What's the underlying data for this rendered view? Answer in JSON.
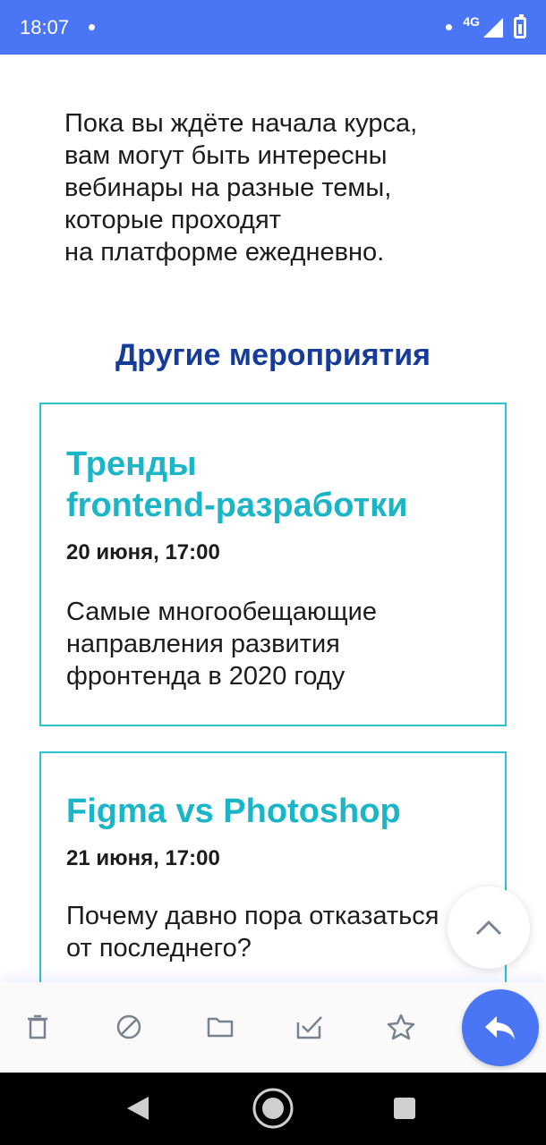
{
  "status_bar": {
    "time": "18:07",
    "network": "4G",
    "icons": [
      "notification-dot-icon",
      "signal-icon",
      "battery-icon"
    ]
  },
  "email": {
    "intro_lines": [
      "Пока вы ждёте начала курса,",
      "вам могут быть интересны",
      "вебинары на разные темы,",
      "которые проходят",
      "на платформе ежедневно."
    ],
    "section_title": "Другие мероприятия",
    "events": [
      {
        "title_lines": [
          "Тренды",
          "frontend-разработки"
        ],
        "date": "20 июня, 17:00",
        "desc_lines": [
          "Самые многообещающие",
          "направления развития",
          "фронтенда в 2020 году"
        ]
      },
      {
        "title_lines": [
          "Figma vs Photoshop"
        ],
        "date": "21 июня, 17:00",
        "desc_lines": [
          "Почему давно пора отказаться",
          "от последнего?"
        ]
      }
    ]
  },
  "toolbar": {
    "icons": [
      "delete-icon",
      "spam-icon",
      "move-to-folder-icon",
      "mark-read-icon",
      "star-icon",
      "reply-icon"
    ]
  },
  "colors": {
    "accent": "#4a76f5",
    "section_title": "#173b99",
    "card_title": "#1bb5c8",
    "card_border": "#2bc3cd"
  }
}
